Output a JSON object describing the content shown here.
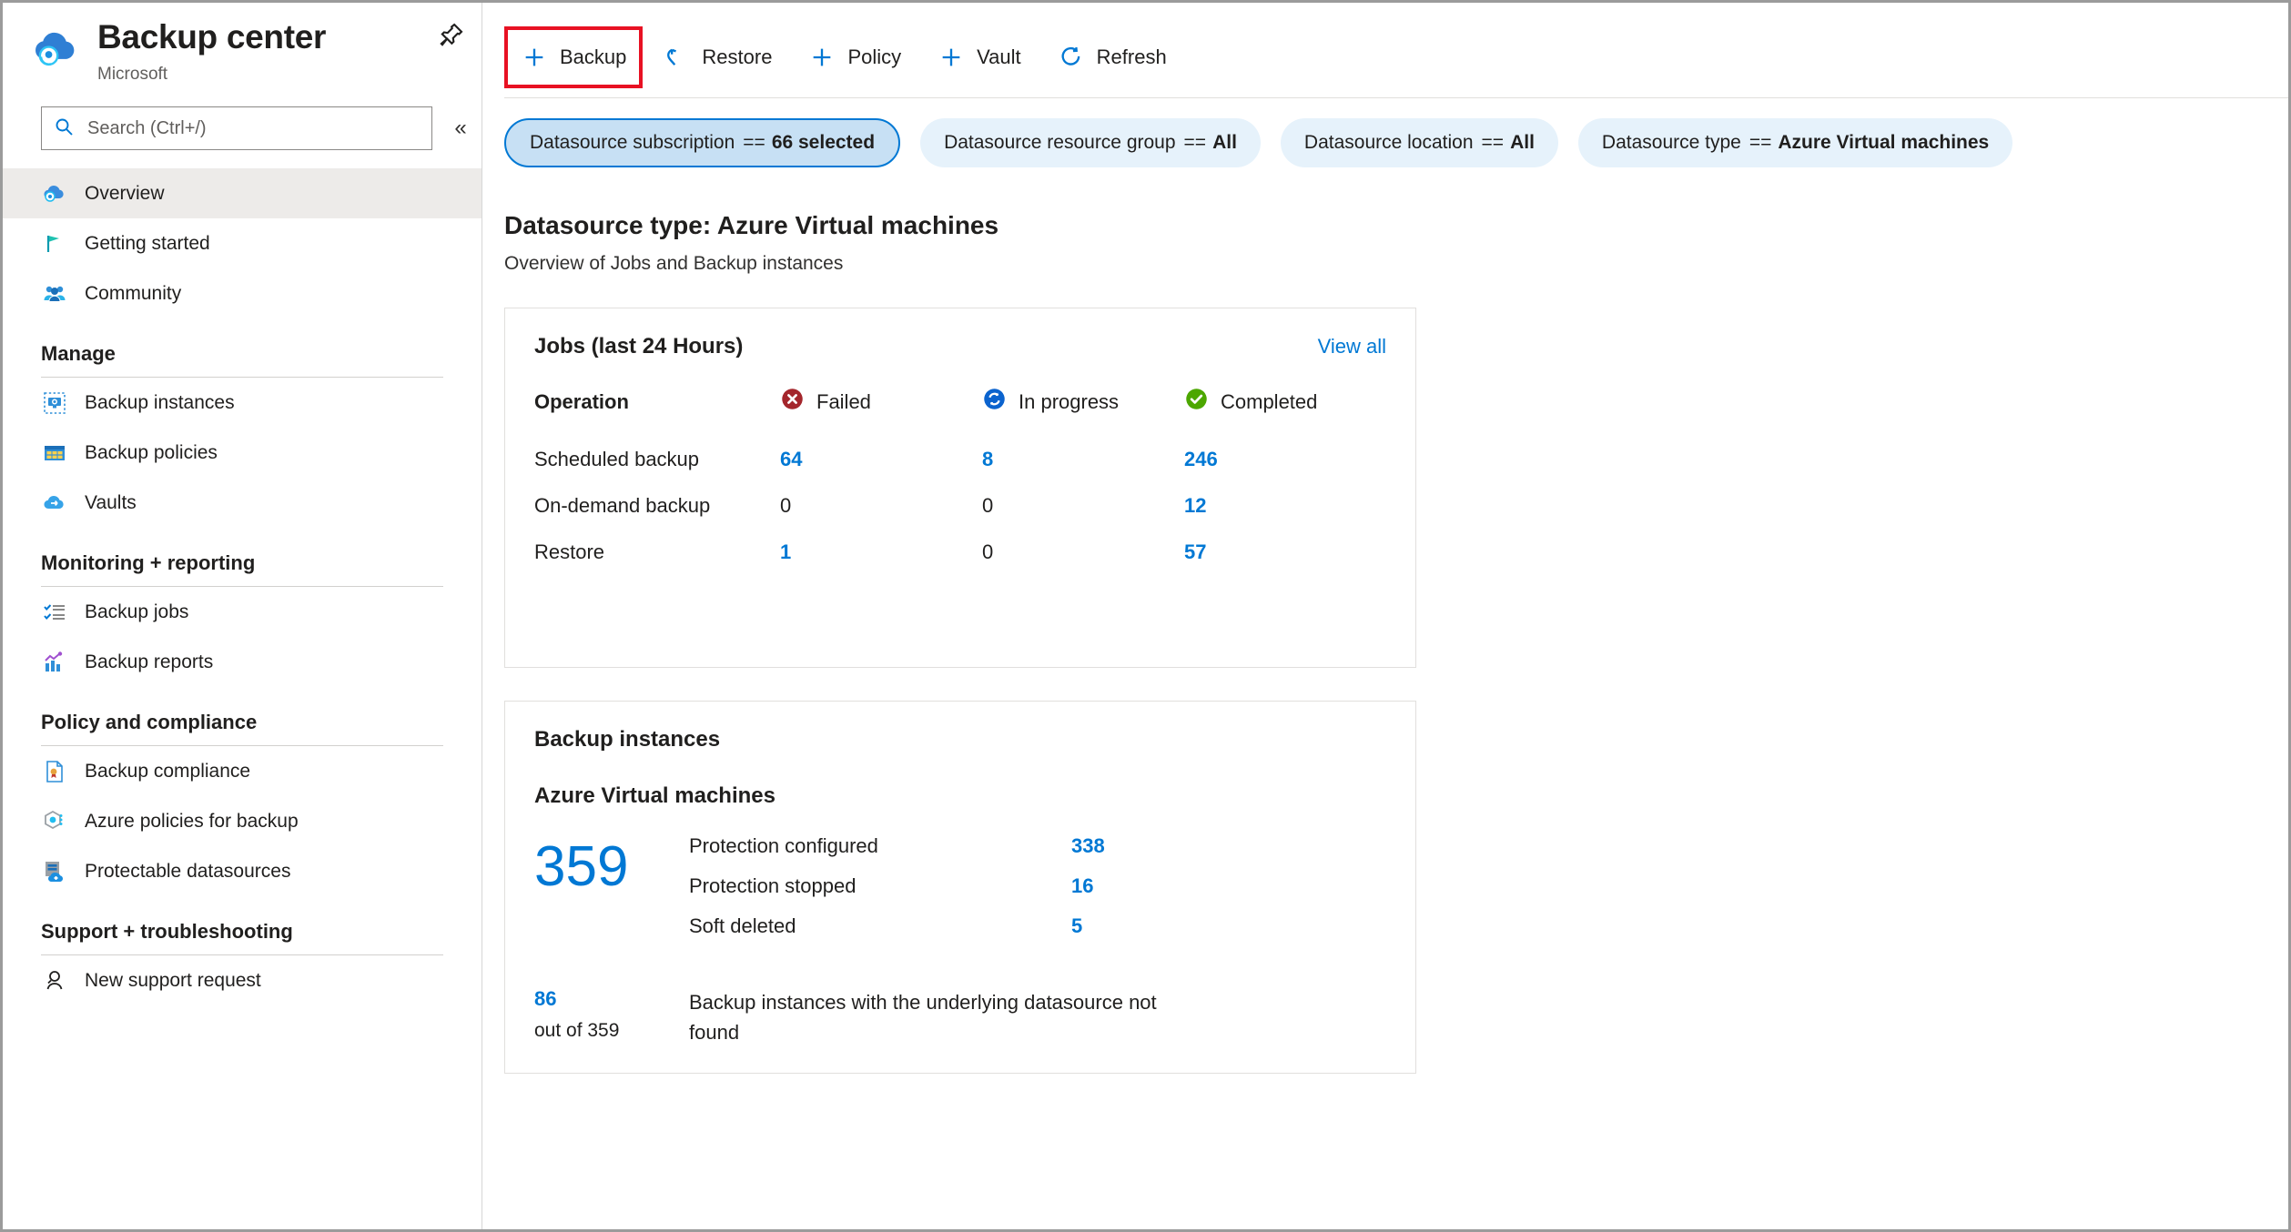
{
  "header": {
    "title": "Backup center",
    "subtitle": "Microsoft",
    "pin_icon": "pin-icon",
    "more_icon": "ellipsis-icon",
    "more_label": "• • •"
  },
  "search": {
    "placeholder": "Search (Ctrl+/)",
    "icon": "search-icon",
    "collapse_label": "«"
  },
  "sidebar": {
    "top_items": [
      {
        "label": "Overview",
        "icon": "cloud-backup-icon",
        "active": true
      },
      {
        "label": "Getting started",
        "icon": "flag-icon",
        "active": false
      },
      {
        "label": "Community",
        "icon": "people-icon",
        "active": false
      }
    ],
    "groups": [
      {
        "title": "Manage",
        "items": [
          {
            "label": "Backup instances",
            "icon": "backup-instance-icon"
          },
          {
            "label": "Backup policies",
            "icon": "policy-table-icon"
          },
          {
            "label": "Vaults",
            "icon": "vault-cloud-icon"
          }
        ]
      },
      {
        "title": "Monitoring + reporting",
        "items": [
          {
            "label": "Backup jobs",
            "icon": "checklist-icon"
          },
          {
            "label": "Backup reports",
            "icon": "bar-chart-icon"
          }
        ]
      },
      {
        "title": "Policy and compliance",
        "items": [
          {
            "label": "Backup compliance",
            "icon": "document-award-icon"
          },
          {
            "label": "Azure policies for backup",
            "icon": "policy-hex-icon"
          },
          {
            "label": "Protectable datasources",
            "icon": "server-cloud-add-icon"
          }
        ]
      },
      {
        "title": "Support + troubleshooting",
        "items": [
          {
            "label": "New support request",
            "icon": "support-person-icon"
          }
        ]
      }
    ]
  },
  "toolbar": {
    "buttons": [
      {
        "label": "Backup",
        "icon": "plus-icon",
        "highlighted": true
      },
      {
        "label": "Restore",
        "icon": "undo-arrow-icon",
        "highlighted": false
      },
      {
        "label": "Policy",
        "icon": "plus-icon",
        "highlighted": false
      },
      {
        "label": "Vault",
        "icon": "plus-icon",
        "highlighted": false
      },
      {
        "label": "Refresh",
        "icon": "refresh-icon",
        "highlighted": false
      }
    ]
  },
  "filters": [
    {
      "name": "Datasource subscription",
      "operator": "==",
      "value": "66 selected",
      "selected": true
    },
    {
      "name": "Datasource resource group",
      "operator": "==",
      "value": "All",
      "selected": false
    },
    {
      "name": "Datasource location",
      "operator": "==",
      "value": "All",
      "selected": false
    },
    {
      "name": "Datasource type",
      "operator": "==",
      "value": "Azure Virtual machines",
      "selected": false
    }
  ],
  "page": {
    "title": "Datasource type: Azure Virtual machines",
    "subtitle": "Overview of Jobs and Backup instances"
  },
  "jobs_card": {
    "title": "Jobs (last 24 Hours)",
    "view_all": "View all",
    "columns": [
      {
        "label": "Operation",
        "icon": null
      },
      {
        "label": "Failed",
        "icon": "error-circle-icon",
        "color": "#a4262c"
      },
      {
        "label": "In progress",
        "icon": "sync-circle-icon",
        "color": "#0078d4"
      },
      {
        "label": "Completed",
        "icon": "check-circle-icon",
        "color": "#4ca700"
      }
    ],
    "rows": [
      {
        "operation": "Scheduled backup",
        "failed": "64",
        "in_progress": "8",
        "completed": "246"
      },
      {
        "operation": "On-demand backup",
        "failed": "0",
        "in_progress": "0",
        "completed": "12"
      },
      {
        "operation": "Restore",
        "failed": "1",
        "in_progress": "0",
        "completed": "57"
      }
    ]
  },
  "instances_card": {
    "title": "Backup instances",
    "datasource_type": "Azure Virtual machines",
    "total": "359",
    "stats": [
      {
        "label": "Protection configured",
        "value": "338"
      },
      {
        "label": "Protection stopped",
        "value": "16"
      },
      {
        "label": "Soft deleted",
        "value": "5"
      }
    ],
    "footer": {
      "value": "86",
      "out_of": "out of 359",
      "text": "Backup instances with the underlying datasource not found"
    }
  },
  "colors": {
    "accent": "#0078d4",
    "error": "#a4262c",
    "success": "#4ca700",
    "highlight": "#e81123"
  }
}
